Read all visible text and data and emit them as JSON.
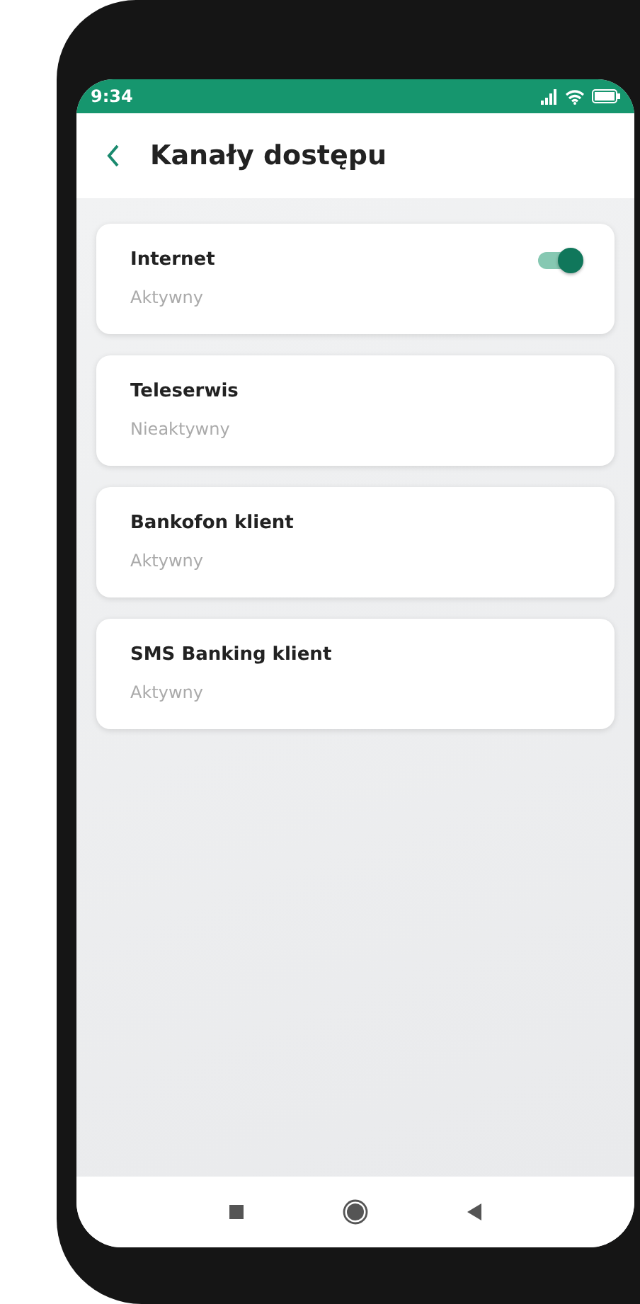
{
  "status_bar": {
    "time": "9:34"
  },
  "header": {
    "title": "Kanały dostępu"
  },
  "channels": [
    {
      "kind": "toggle",
      "name": "Internet",
      "status": "Aktywny",
      "on": true
    },
    {
      "kind": "plain",
      "name": "Teleserwis",
      "status": "Nieaktywny"
    },
    {
      "kind": "plain",
      "name": "Bankofon klient",
      "status": "Aktywny"
    },
    {
      "kind": "plain",
      "name": "SMS Banking klient",
      "status": "Aktywny"
    }
  ]
}
